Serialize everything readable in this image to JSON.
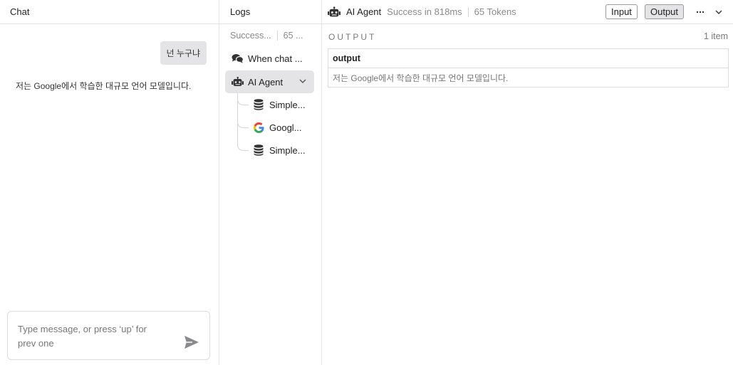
{
  "chat": {
    "title": "Chat",
    "messages": [
      {
        "role": "user",
        "text": "넌 누구냐"
      },
      {
        "role": "bot",
        "text": "저는 Google에서 학습한 대규모 언어 모델입니다."
      }
    ],
    "input_placeholder": "Type message, or press ‘up’ for prev one"
  },
  "logs": {
    "title": "Logs",
    "summary_status": "Success...",
    "summary_tokens": "65 ...",
    "items": [
      {
        "label": "When chat ...",
        "icon": "chat-bubbles-icon"
      },
      {
        "label": "AI Agent",
        "icon": "robot-icon",
        "selected": true
      },
      {
        "label": "Simple...",
        "icon": "database-icon"
      },
      {
        "label": "Googl...",
        "icon": "google-icon"
      },
      {
        "label": "Simple...",
        "icon": "database-icon"
      }
    ]
  },
  "detail": {
    "title": "AI Agent",
    "status": "Success in 818ms",
    "tokens": "65 Tokens",
    "input_button": "Input",
    "output_button": "Output",
    "section_label": "OUTPUT",
    "item_count": "1 item",
    "table_header": "output",
    "table_value": "저는 Google에서 학습한 대규모 언어 모델입니다."
  },
  "colors": {
    "selected_bg": "#e4e4e7",
    "border": "#e4e4e7",
    "muted_text": "#8a8a8a"
  }
}
